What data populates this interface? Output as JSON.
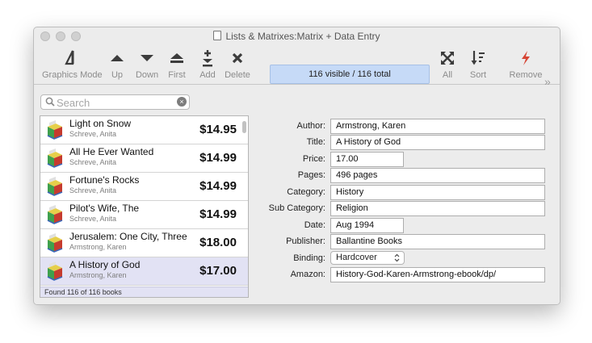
{
  "window": {
    "title": "Lists & Matrixes:Matrix + Data Entry"
  },
  "toolbar": {
    "graphics_mode": "Graphics Mode",
    "up": "Up",
    "down": "Down",
    "first": "First",
    "add": "Add",
    "delete": "Delete",
    "status": "116 visible / 116 total",
    "all": "All",
    "sort": "Sort",
    "remove": "Remove",
    "overflow": "»"
  },
  "search": {
    "placeholder": "Search",
    "clear": "×"
  },
  "list": {
    "rows": [
      {
        "title": "Light on Snow",
        "author": "Schreve, Anita",
        "price": "$14.95"
      },
      {
        "title": "All He Ever Wanted",
        "author": "Schreve, Anita",
        "price": "$14.99"
      },
      {
        "title": "Fortune's Rocks",
        "author": "Schreve, Anita",
        "price": "$14.99"
      },
      {
        "title": "Pilot's Wife, The",
        "author": "Schreve, Anita",
        "price": "$14.99"
      },
      {
        "title": "Jerusalem: One City, Three",
        "author": "Armstrong, Karen",
        "price": "$18.00"
      },
      {
        "title": "A History of God",
        "author": "Armstrong, Karen",
        "price": "$17.00"
      }
    ],
    "selected_index": 5,
    "footer": "Found 116 of 116 books"
  },
  "form": {
    "labels": {
      "author": "Author:",
      "title": "Title:",
      "price": "Price:",
      "pages": "Pages:",
      "category": "Category:",
      "subcategory": "Sub Category:",
      "date": "Date:",
      "publisher": "Publisher:",
      "binding": "Binding:",
      "amazon": "Amazon:"
    },
    "values": {
      "author": "Armstrong, Karen",
      "title": "A History of God",
      "price": "17.00",
      "pages": "496 pages",
      "category": "History",
      "subcategory": "Religion",
      "date": "Aug 1994",
      "publisher": "Ballantine Books",
      "binding": "Hardcover",
      "amazon": "History-God-Karen-Armstrong-ebook/dp/"
    }
  },
  "colors": {
    "status_bg": "#c6daf7",
    "selected_row": "#e2e2f4",
    "remove_icon": "#d64535"
  }
}
